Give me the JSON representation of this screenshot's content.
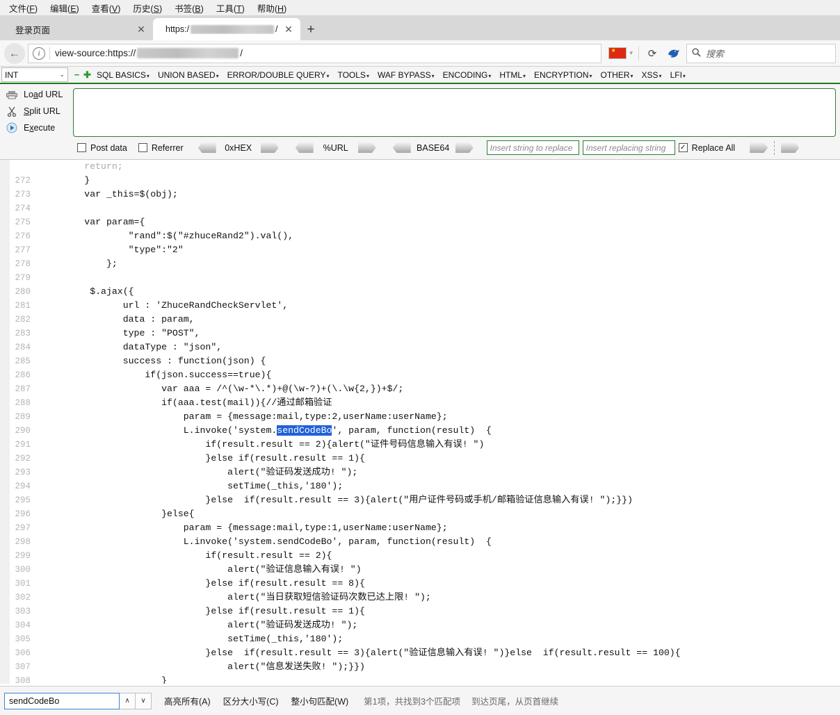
{
  "menubar": {
    "items": [
      {
        "label": "文件",
        "accel": "F"
      },
      {
        "label": "编辑",
        "accel": "E"
      },
      {
        "label": "查看",
        "accel": "V"
      },
      {
        "label": "历史",
        "accel": "S"
      },
      {
        "label": "书签",
        "accel": "B"
      },
      {
        "label": "工具",
        "accel": "T"
      },
      {
        "label": "帮助",
        "accel": "H"
      }
    ]
  },
  "tabs": {
    "items": [
      {
        "title": "登录页面",
        "active": false,
        "redacted": false
      },
      {
        "title": "https:/",
        "suffix": "/",
        "active": true,
        "redacted": true
      }
    ],
    "new_tab_label": "+"
  },
  "navbar": {
    "back_icon": "←",
    "info_icon": "i",
    "url_prefix": "view-source:https://",
    "url_suffix": "/",
    "flag_label": "CN",
    "dropdown_caret": "▾",
    "reload_icon": "⟳",
    "bird_icon": "bird",
    "search_icon": "🔍",
    "search_placeholder": "搜索",
    "search_value": ""
  },
  "hackbar": {
    "int_select": "INT",
    "int_caret": "⌄",
    "minus": "−",
    "plus": "✚",
    "menus": [
      {
        "label": "SQL BASICS",
        "caret": "▾"
      },
      {
        "label": "UNION BASED",
        "caret": "▾"
      },
      {
        "label": "ERROR/DOUBLE QUERY",
        "caret": "▾"
      },
      {
        "label": "TOOLS",
        "caret": "▾"
      },
      {
        "label": "WAF BYPASS",
        "caret": "▾"
      },
      {
        "label": "ENCODING",
        "caret": "▾"
      },
      {
        "label": "HTML",
        "caret": "▾"
      },
      {
        "label": "ENCRYPTION",
        "caret": "▾"
      },
      {
        "label": "OTHER",
        "caret": "▾"
      },
      {
        "label": "XSS",
        "caret": "▾"
      },
      {
        "label": "LFI",
        "caret": "▾"
      }
    ],
    "actions": [
      {
        "label": "Load URL",
        "icon": "printer-icon"
      },
      {
        "label": "Split URL",
        "icon": "scissors-icon"
      },
      {
        "label": "Execute",
        "icon": "play-icon"
      }
    ],
    "url_textarea_value": "",
    "checkboxes": [
      {
        "label": "Post data",
        "checked": false
      },
      {
        "label": "Referrer",
        "checked": false
      }
    ],
    "encoders": [
      {
        "label": "0xHEX"
      },
      {
        "label": "%URL"
      },
      {
        "label": "BASE64"
      }
    ],
    "replace_search_placeholder": "Insert string to replace",
    "replace_search_value": "",
    "replace_with_placeholder": "Insert replacing string",
    "replace_with_value": "",
    "replace_all_label": "Replace All",
    "replace_all_checked": true
  },
  "source": {
    "first_line_partial": "return;",
    "lines": [
      {
        "n": "272",
        "code": "        }"
      },
      {
        "n": "273",
        "code": "        var _this=$(obj);"
      },
      {
        "n": "274",
        "code": ""
      },
      {
        "n": "275",
        "code": "        var param={"
      },
      {
        "n": "276",
        "code": "                \"rand\":$(\"#zhuceRand2\").val(),"
      },
      {
        "n": "277",
        "code": "                \"type\":\"2\""
      },
      {
        "n": "278",
        "code": "            };"
      },
      {
        "n": "279",
        "code": ""
      },
      {
        "n": "280",
        "code": "         $.ajax({"
      },
      {
        "n": "281",
        "code": "               url : 'ZhuceRandCheckServlet',"
      },
      {
        "n": "282",
        "code": "               data : param,"
      },
      {
        "n": "283",
        "code": "               type : \"POST\","
      },
      {
        "n": "284",
        "code": "               dataType : \"json\","
      },
      {
        "n": "285",
        "code": "               success : function(json) {"
      },
      {
        "n": "286",
        "code": "                   if(json.success==true){"
      },
      {
        "n": "287",
        "code": "                      var aaa = /^(\\w-*\\.*)+@(\\w-?)+(\\.\\w{2,})+$/;"
      },
      {
        "n": "288",
        "code": "                      if(aaa.test(mail)){//通过邮箱验证"
      },
      {
        "n": "289",
        "code": "                          param = {message:mail,type:2,userName:userName};"
      },
      {
        "n": "290",
        "code": "                          L.invoke('system.",
        "hl": "sendCodeBo",
        "code_after": "', param, function(result)  {"
      },
      {
        "n": "291",
        "code": "                              if(result.result == 2){alert(\"证件号码信息输入有误! \")"
      },
      {
        "n": "292",
        "code": "                              }else if(result.result == 1){"
      },
      {
        "n": "293",
        "code": "                                  alert(\"验证码发送成功! \");"
      },
      {
        "n": "294",
        "code": "                                  setTime(_this,'180');"
      },
      {
        "n": "295",
        "code": "                              }else  if(result.result == 3){alert(\"用户证件号码或手机/邮箱验证信息输入有误! \");}})"
      },
      {
        "n": "296",
        "code": "                      }else{"
      },
      {
        "n": "297",
        "code": "                          param = {message:mail,type:1,userName:userName};"
      },
      {
        "n": "298",
        "code": "                          L.invoke('system.sendCodeBo', param, function(result)  {"
      },
      {
        "n": "299",
        "code": "                              if(result.result == 2){"
      },
      {
        "n": "300",
        "code": "                                  alert(\"验证信息输入有误! \")"
      },
      {
        "n": "301",
        "code": "                              }else if(result.result == 8){"
      },
      {
        "n": "302",
        "code": "                                  alert(\"当日获取短信验证码次数已达上限! \");"
      },
      {
        "n": "303",
        "code": "                              }else if(result.result == 1){"
      },
      {
        "n": "304",
        "code": "                                  alert(\"验证码发送成功! \");"
      },
      {
        "n": "305",
        "code": "                                  setTime(_this,'180');"
      },
      {
        "n": "306",
        "code": "                              }else  if(result.result == 3){alert(\"验证信息输入有误! \")}else  if(result.result == 100){"
      },
      {
        "n": "307",
        "code": "                                  alert(\"信息发送失败! \");}})"
      },
      {
        "n": "308",
        "code": "                      }"
      }
    ]
  },
  "findbar": {
    "query": "sendCodeBo",
    "prev_icon": "∧",
    "next_icon": "∨",
    "highlight_all": "高亮所有(A)",
    "match_case": "区分大小写(C)",
    "match_whole": "整小句匹配(W)",
    "status": "第1项，共找到3个匹配项",
    "wrap_notice": "到达页尾，从页首继续"
  }
}
